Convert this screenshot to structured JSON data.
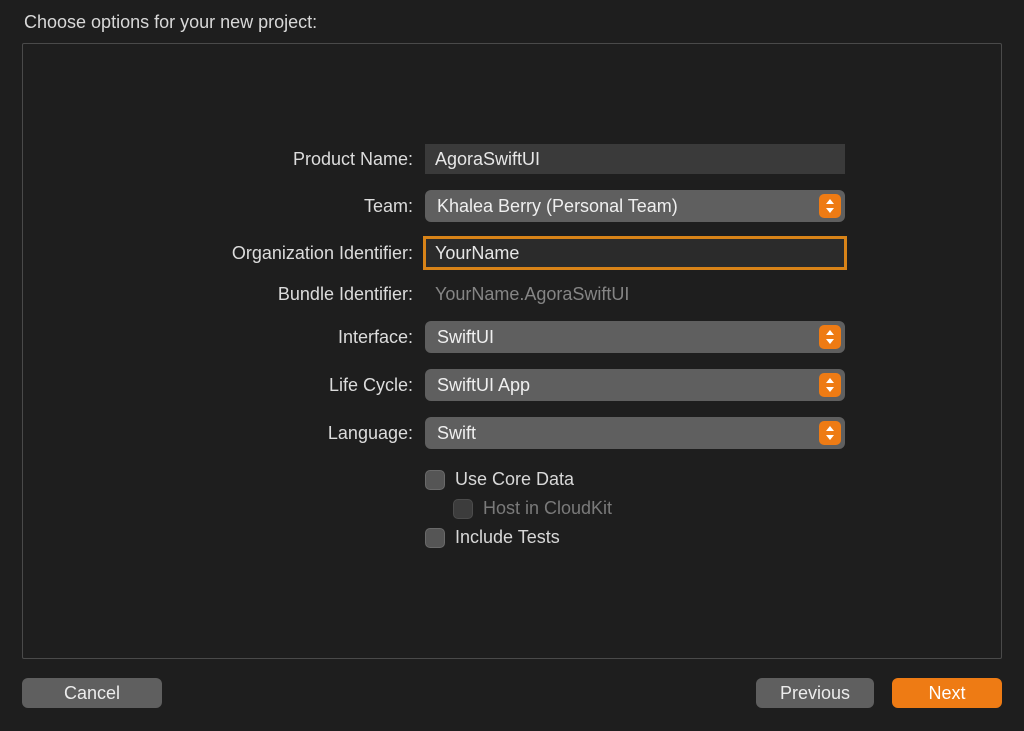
{
  "colors": {
    "accent": "#ee7b14",
    "focus_ring": "#d88318",
    "panel_border": "#4a4a4a",
    "background": "#1e1e1e",
    "control_bg": "#5f5f5f",
    "input_bg": "#3a3a3a"
  },
  "header": {
    "title": "Choose options for your new project:"
  },
  "form": {
    "product_name": {
      "label": "Product Name:",
      "value": "AgoraSwiftUI"
    },
    "team": {
      "label": "Team:",
      "selected": "Khalea Berry (Personal Team)"
    },
    "org_identifier": {
      "label": "Organization Identifier:",
      "value": "YourName"
    },
    "bundle_identifier": {
      "label": "Bundle Identifier:",
      "value": "YourName.AgoraSwiftUI"
    },
    "interface": {
      "label": "Interface:",
      "selected": "SwiftUI"
    },
    "life_cycle": {
      "label": "Life Cycle:",
      "selected": "SwiftUI App"
    },
    "language": {
      "label": "Language:",
      "selected": "Swift"
    },
    "use_core_data": {
      "label": "Use Core Data",
      "checked": false
    },
    "host_cloudkit": {
      "label": "Host in CloudKit",
      "checked": false,
      "disabled": true
    },
    "include_tests": {
      "label": "Include Tests",
      "checked": false
    }
  },
  "buttons": {
    "cancel": "Cancel",
    "previous": "Previous",
    "next": "Next"
  }
}
